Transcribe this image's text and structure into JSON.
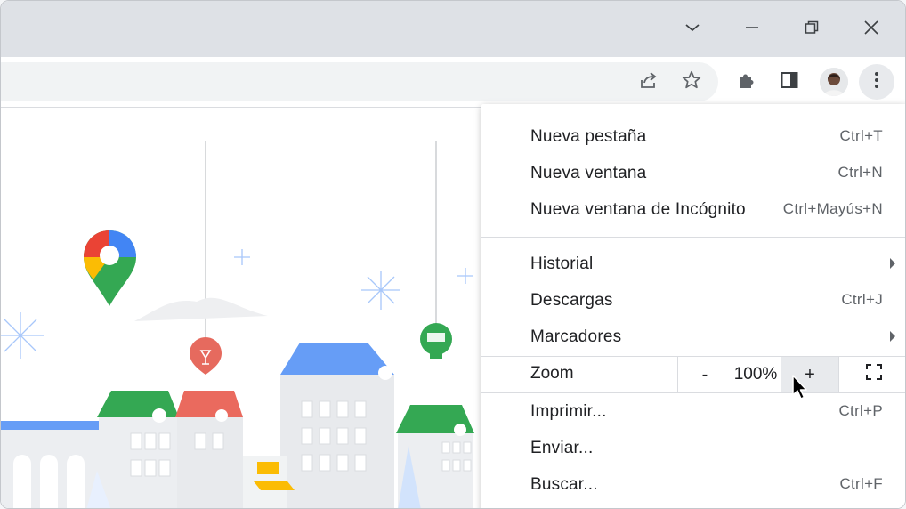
{
  "window_controls": {
    "tab_search": "chevron-down-icon",
    "minimize": "minimize-icon",
    "restore": "restore-icon",
    "close": "close-icon"
  },
  "toolbar": {
    "share_icon": "share-icon",
    "bookmark_icon": "star-icon",
    "extensions_icon": "puzzle-icon",
    "side_panel_icon": "side-panel-icon",
    "profile_icon": "avatar",
    "menu_icon": "three-dots-vertical-icon"
  },
  "menu": {
    "group1": [
      {
        "label": "Nueva pestaña",
        "shortcut": "Ctrl+T"
      },
      {
        "label": "Nueva ventana",
        "shortcut": "Ctrl+N"
      },
      {
        "label": "Nueva ventana de Incógnito",
        "shortcut": "Ctrl+Mayús+N"
      }
    ],
    "group2": [
      {
        "label": "Historial",
        "shortcut": ""
      },
      {
        "label": "Descargas",
        "shortcut": "Ctrl+J"
      },
      {
        "label": "Marcadores",
        "shortcut": ""
      }
    ],
    "zoom": {
      "label": "Zoom",
      "minus": "-",
      "value": "100%",
      "plus": "+"
    },
    "group3": [
      {
        "label": "Imprimir...",
        "shortcut": "Ctrl+P"
      },
      {
        "label": "Enviar...",
        "shortcut": ""
      },
      {
        "label": "Buscar...",
        "shortcut": "Ctrl+F"
      }
    ]
  },
  "colors": {
    "titlebar": "#dee1e6",
    "omnibox": "#f1f3f4",
    "menu_highlight": "#e8eaed",
    "maps_blue": "#4285f4",
    "maps_red": "#ea4335",
    "maps_yellow": "#fbbc04",
    "maps_green": "#34a853"
  }
}
